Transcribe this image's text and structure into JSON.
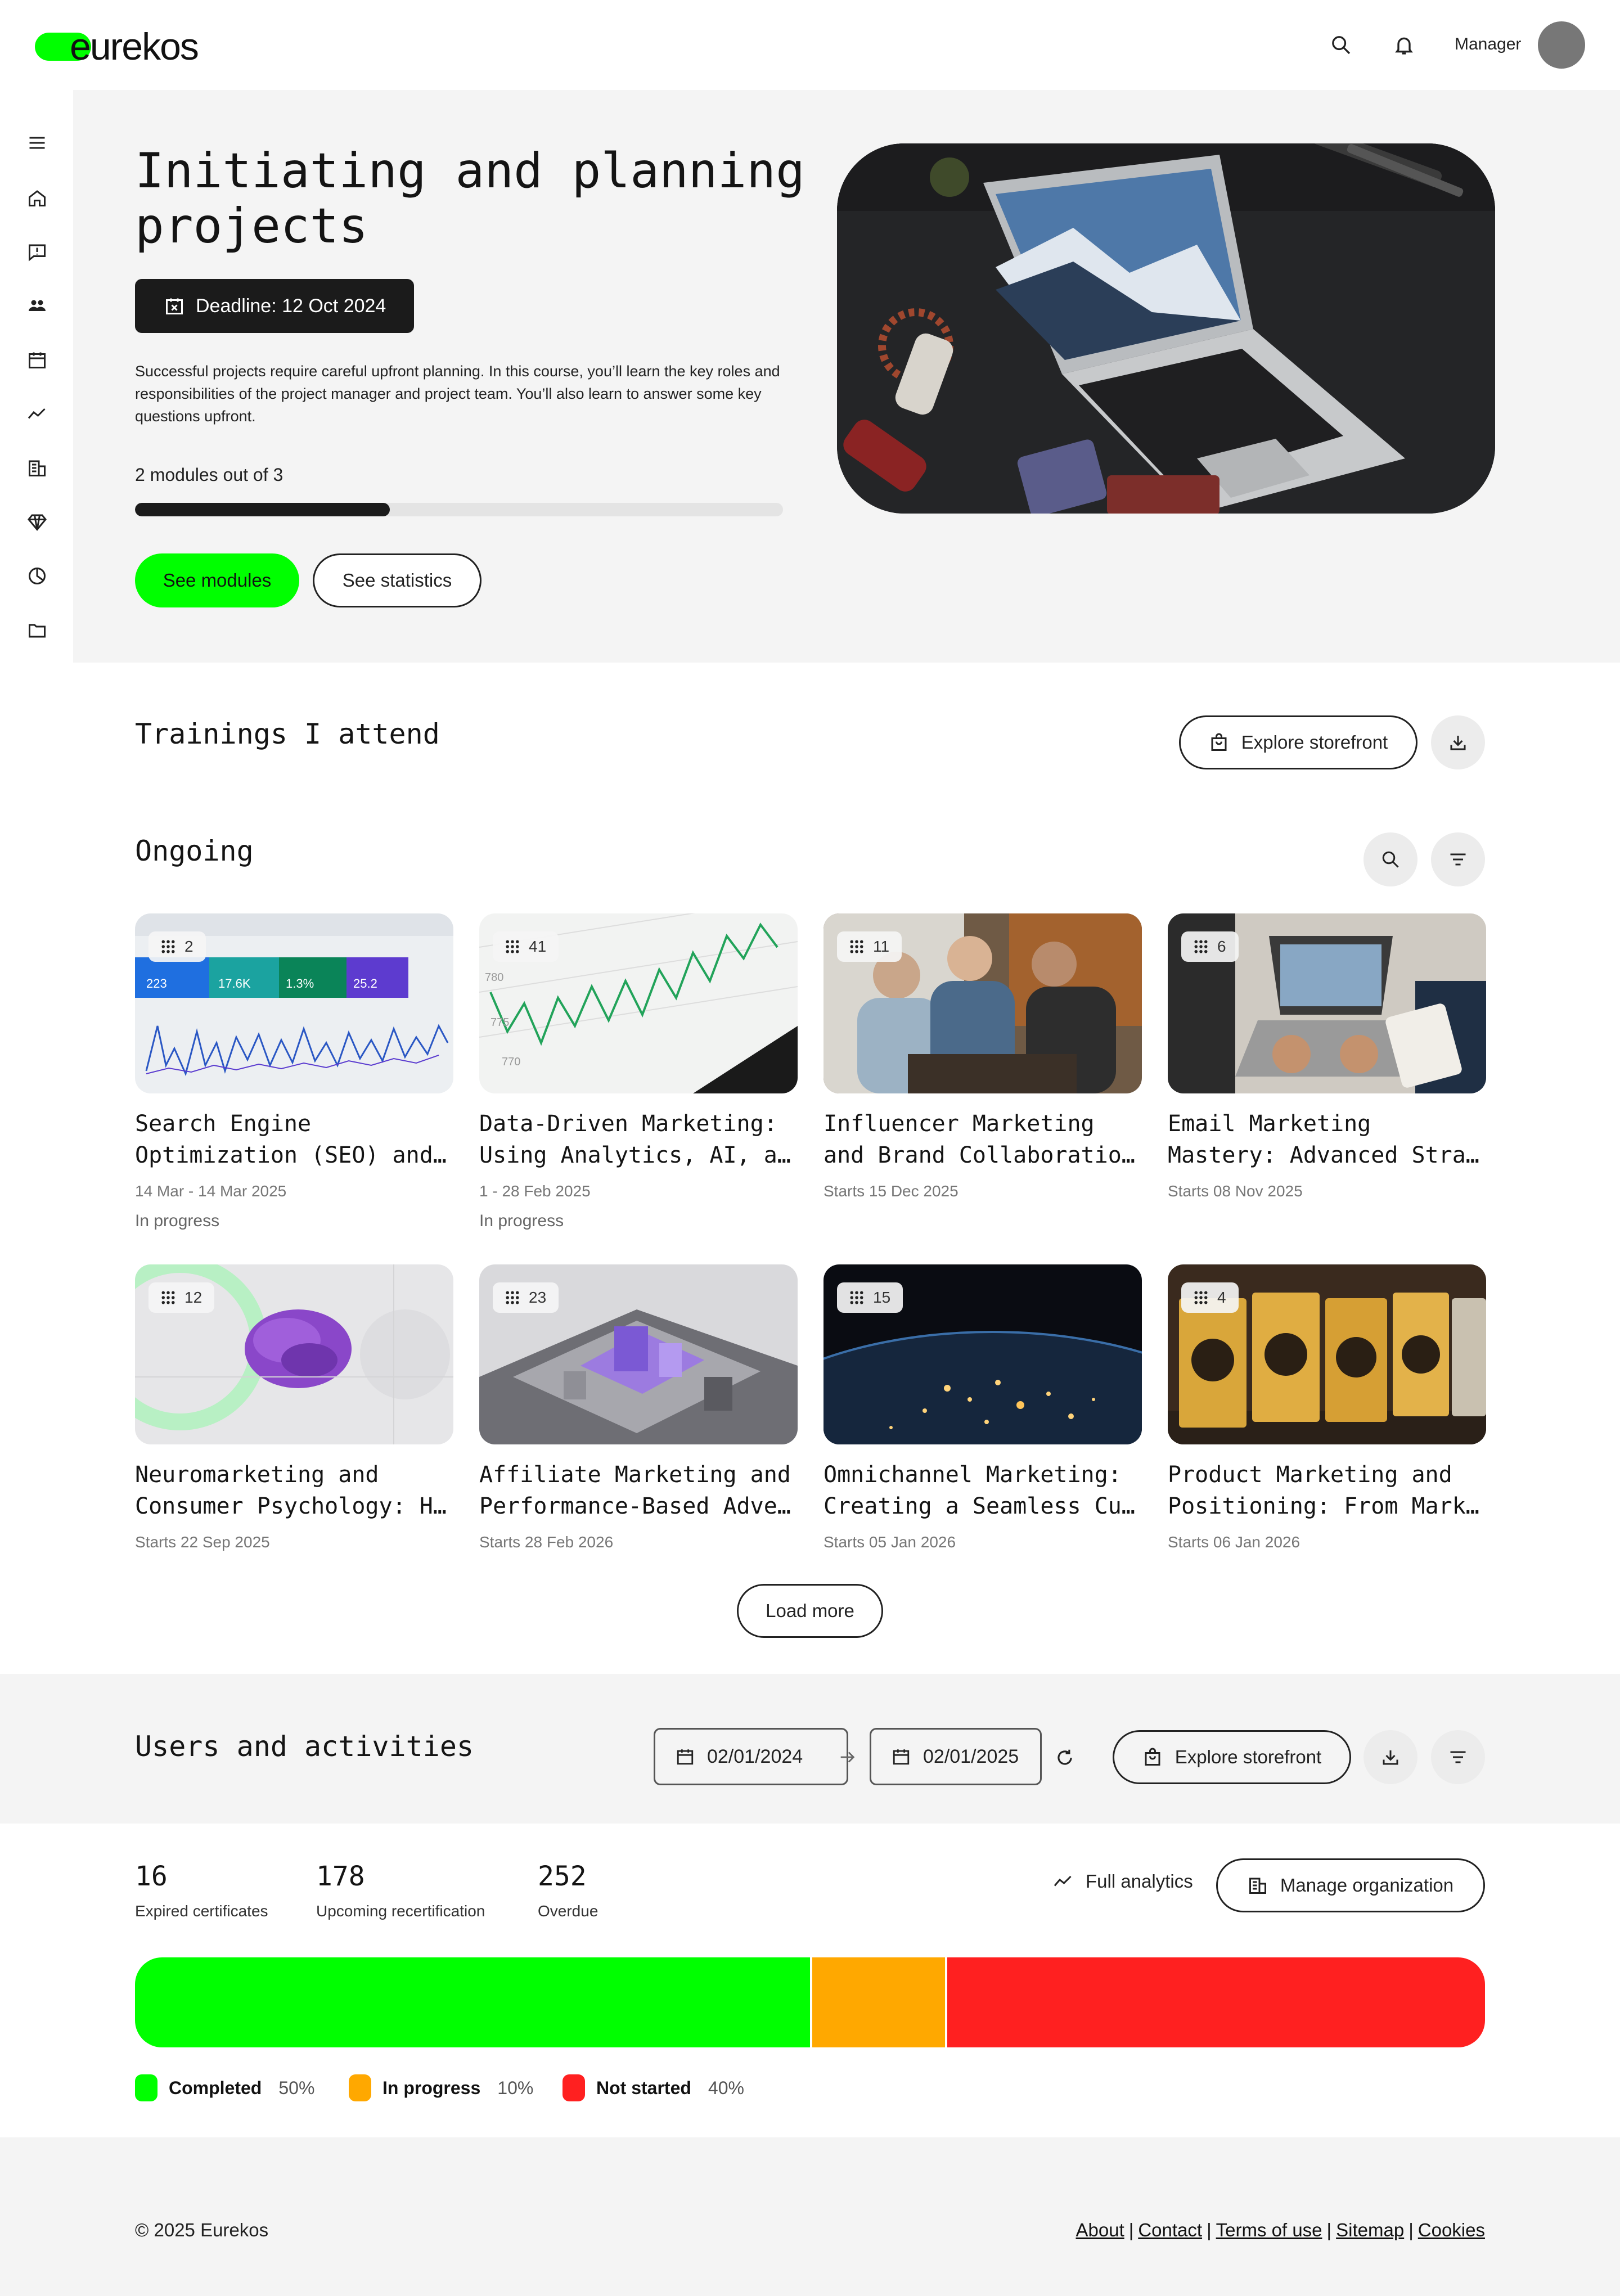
{
  "brand": {
    "name": "eurekos",
    "accent": "#00ff00"
  },
  "header": {
    "user_label": "Manager",
    "icons": [
      "search-icon",
      "bell-icon"
    ]
  },
  "sidebar": {
    "icons": [
      "menu-icon",
      "home-icon",
      "feedback-icon",
      "users-icon",
      "calendar-icon",
      "analytics-icon",
      "organization-icon",
      "diamond-icon",
      "pie-chart-icon",
      "folder-icon"
    ]
  },
  "hero": {
    "title": "Initiating and planning projects",
    "deadline": "Deadline: 12 Oct 2024",
    "description": "Successful projects require careful upfront planning. In this course, you’ll learn the key roles and responsibilities of the project manager and project team. You’ll also learn to answer some key questions upfront.",
    "modules_text": "2 modules out of 3",
    "progress_fraction": 0.3933,
    "see_modules": "See modules",
    "see_statistics": "See statistics"
  },
  "trainings": {
    "title": "Trainings I attend",
    "explore_label": "Explore storefront"
  },
  "ongoing": {
    "title": "Ongoing",
    "cards": [
      {
        "count": "2",
        "title": "Search Engine Optimization (SEO) and…",
        "line1": "Search Engine",
        "line2": "Optimization (SEO) and…",
        "date": "14 Mar - 14 Mar 2025",
        "status": "In progress"
      },
      {
        "count": "41",
        "title": "Data-Driven Marketing: Using Analytics, AI, a…",
        "line1": "Data-Driven Marketing:",
        "line2": "Using Analytics, AI, a…",
        "date": "1 - 28 Feb 2025",
        "status": "In progress"
      },
      {
        "count": "11",
        "line1": "Influencer Marketing",
        "line2": "and Brand Collaboratio…",
        "date": "Starts 15 Dec 2025",
        "status": ""
      },
      {
        "count": "6",
        "line1": "Email Marketing",
        "line2": "Mastery: Advanced Stra…",
        "date": "Starts 08 Nov 2025",
        "status": ""
      },
      {
        "count": "12",
        "line1": "Neuromarketing and",
        "line2": "Consumer Psychology: H…",
        "date": "Starts 22 Sep 2025",
        "status": ""
      },
      {
        "count": "23",
        "line1": "Affiliate Marketing and",
        "line2": "Performance-Based Adve…",
        "date": "Starts 28 Feb 2026",
        "status": ""
      },
      {
        "count": "15",
        "line1": "Omnichannel Marketing:",
        "line2": "Creating a Seamless Cu…",
        "date": "Starts 05 Jan 2026",
        "status": ""
      },
      {
        "count": "4",
        "line1": "Product Marketing and",
        "line2": "Positioning: From Mark…",
        "date": "Starts 06 Jan 2026",
        "status": ""
      }
    ],
    "load_more": "Load more"
  },
  "users": {
    "title": "Users and activities",
    "date_from": "02/01/2024",
    "date_to": "02/01/2025",
    "explore_label": "Explore storefront",
    "stats": [
      {
        "value": "16",
        "label": "Expired certificates"
      },
      {
        "value": "178",
        "label": "Upcoming recertification"
      },
      {
        "value": "252",
        "label": "Overdue"
      }
    ],
    "full_analytics": "Full analytics",
    "manage_org": "Manage organization",
    "breakdown": [
      {
        "label": "Completed",
        "pct_text": "50%",
        "value": 50,
        "color": "#00ff00"
      },
      {
        "label": "In progress",
        "pct_text": "10%",
        "value": 10,
        "color": "#ffa800"
      },
      {
        "label": "Not started",
        "pct_text": "40%",
        "value": 40,
        "color": "#ff2020"
      }
    ]
  },
  "footer": {
    "copyright": "© 2025 Eurekos",
    "links": [
      "About",
      "Contact",
      "Terms of use",
      "Sitemap",
      "Cookies"
    ]
  }
}
